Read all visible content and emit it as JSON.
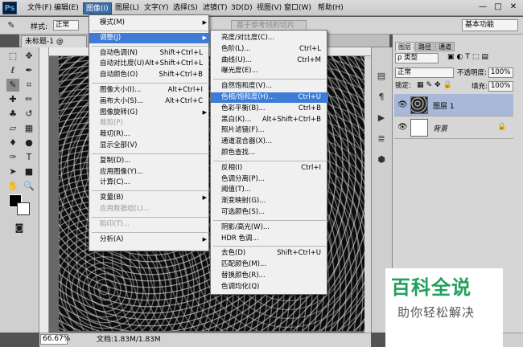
{
  "app_logo": "Ps",
  "menubar": {
    "items": [
      "文件(F)",
      "编辑(E)",
      "图像(I)",
      "图层(L)",
      "文字(Y)",
      "选择(S)",
      "滤镜(T)",
      "3D(D)",
      "视图(V)",
      "窗口(W)",
      "帮助(H)"
    ],
    "active_index": 2
  },
  "window_controls": [
    "—",
    "□",
    "✕"
  ],
  "options": {
    "style_label": "样式:",
    "style_value": "正常",
    "slice_button": "基于参考线的切片",
    "workspace": "基本功能"
  },
  "document": {
    "tab_title": "未标题-1 @",
    "zoom": "66.67%",
    "doc_info": "文档:1.83M/1.83M"
  },
  "image_menu": {
    "items": [
      {
        "label": "模式(M)",
        "shortcut": "",
        "submenu": true,
        "disabled": false
      },
      {
        "sep": true
      },
      {
        "label": "调整(J)",
        "shortcut": "",
        "submenu": true,
        "disabled": false,
        "highlight": true
      },
      {
        "sep": true
      },
      {
        "label": "自动色调(N)",
        "shortcut": "Shift+Ctrl+L",
        "disabled": false
      },
      {
        "label": "自动对比度(U)",
        "shortcut": "Alt+Shift+Ctrl+L",
        "disabled": false
      },
      {
        "label": "自动颜色(O)",
        "shortcut": "Shift+Ctrl+B",
        "disabled": false
      },
      {
        "sep": true
      },
      {
        "label": "图像大小(I)...",
        "shortcut": "Alt+Ctrl+I",
        "disabled": false
      },
      {
        "label": "画布大小(S)...",
        "shortcut": "Alt+Ctrl+C",
        "disabled": false
      },
      {
        "label": "图像旋转(G)",
        "shortcut": "",
        "submenu": true,
        "disabled": false
      },
      {
        "label": "裁剪(P)",
        "shortcut": "",
        "disabled": true
      },
      {
        "label": "裁切(R)...",
        "shortcut": "",
        "disabled": false
      },
      {
        "label": "显示全部(V)",
        "shortcut": "",
        "disabled": false
      },
      {
        "sep": true
      },
      {
        "label": "复制(D)...",
        "shortcut": "",
        "disabled": false
      },
      {
        "label": "应用图像(Y)...",
        "shortcut": "",
        "disabled": false
      },
      {
        "label": "计算(C)...",
        "shortcut": "",
        "disabled": false
      },
      {
        "sep": true
      },
      {
        "label": "变量(B)",
        "shortcut": "",
        "submenu": true,
        "disabled": false
      },
      {
        "label": "应用数据组(L)...",
        "shortcut": "",
        "disabled": true
      },
      {
        "sep": true
      },
      {
        "label": "陷印(T)...",
        "shortcut": "",
        "disabled": true
      },
      {
        "sep": true
      },
      {
        "label": "分析(A)",
        "shortcut": "",
        "submenu": true,
        "disabled": false
      }
    ]
  },
  "adjust_menu": {
    "items": [
      {
        "label": "亮度/对比度(C)...",
        "shortcut": ""
      },
      {
        "label": "色阶(L)...",
        "shortcut": "Ctrl+L"
      },
      {
        "label": "曲线(U)...",
        "shortcut": "Ctrl+M"
      },
      {
        "label": "曝光度(E)...",
        "shortcut": ""
      },
      {
        "sep": true
      },
      {
        "label": "自然饱和度(V)...",
        "shortcut": ""
      },
      {
        "label": "色相/饱和度(H)...",
        "shortcut": "Ctrl+U",
        "highlight": true
      },
      {
        "label": "色彩平衡(B)...",
        "shortcut": "Ctrl+B"
      },
      {
        "label": "黑白(K)...",
        "shortcut": "Alt+Shift+Ctrl+B"
      },
      {
        "label": "照片滤镜(F)...",
        "shortcut": ""
      },
      {
        "label": "通道混合器(X)...",
        "shortcut": ""
      },
      {
        "label": "颜色查找...",
        "shortcut": ""
      },
      {
        "sep": true
      },
      {
        "label": "反相(I)",
        "shortcut": "Ctrl+I"
      },
      {
        "label": "色调分离(P)...",
        "shortcut": ""
      },
      {
        "label": "阈值(T)...",
        "shortcut": ""
      },
      {
        "label": "渐变映射(G)...",
        "shortcut": ""
      },
      {
        "label": "可选颜色(S)...",
        "shortcut": ""
      },
      {
        "sep": true
      },
      {
        "label": "阴影/高光(W)...",
        "shortcut": ""
      },
      {
        "label": "HDR 色调...",
        "shortcut": ""
      },
      {
        "sep": true
      },
      {
        "label": "去色(D)",
        "shortcut": "Shift+Ctrl+U"
      },
      {
        "label": "匹配颜色(M)...",
        "shortcut": ""
      },
      {
        "label": "替换颜色(R)...",
        "shortcut": ""
      },
      {
        "label": "色调均化(Q)",
        "shortcut": ""
      }
    ]
  },
  "layers_panel": {
    "tabs": [
      "图层",
      "路径",
      "通道"
    ],
    "kind_filter": "ρ 类型",
    "blend_mode": "正常",
    "opacity_label": "不透明度:",
    "opacity_value": "100%",
    "lock_label": "锁定:",
    "fill_label": "填充:",
    "fill_value": "100%",
    "layers": [
      {
        "name": "图层 1",
        "selected": true
      },
      {
        "name": "背景",
        "selected": false,
        "locked": true
      }
    ],
    "footer_icons": [
      "⊖",
      "fx",
      "◙",
      "◐",
      "▭",
      "⊞",
      "🗑"
    ]
  },
  "watermark": {
    "line1": "百科全说",
    "line2": "助你轻松解决"
  }
}
